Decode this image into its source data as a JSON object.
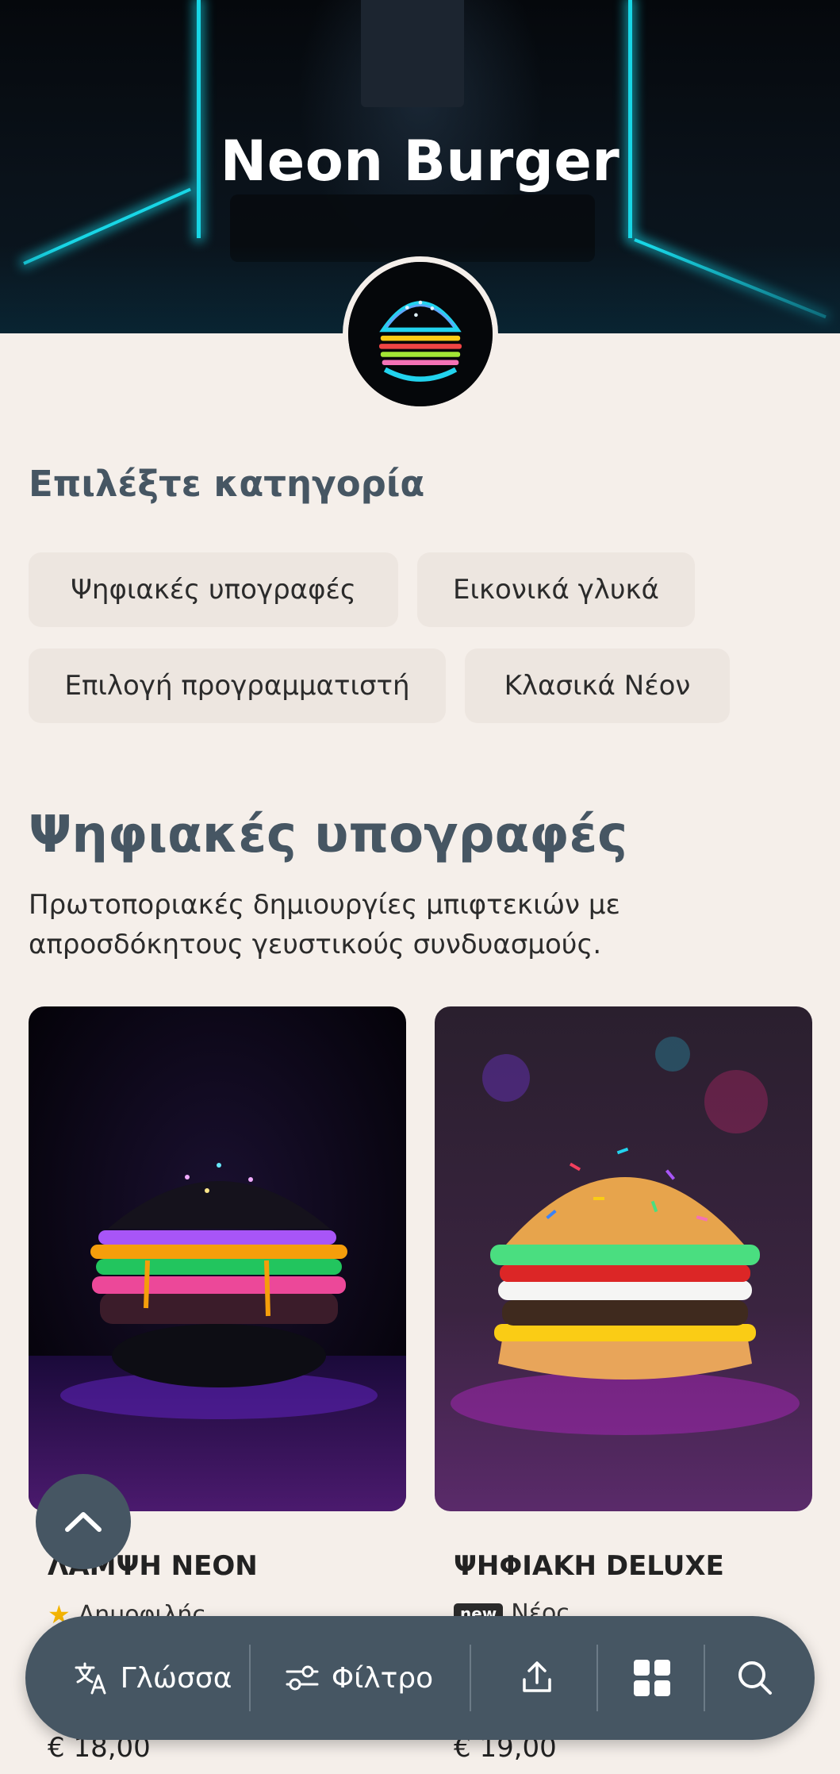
{
  "restaurant": {
    "name": "Neon Burger"
  },
  "categories": {
    "title": "Επιλέξτε κατηγορία",
    "items": [
      "Ψηφιακές υπογραφές",
      "Εικονικά γλυκά",
      "Επιλογή προγραμματιστή",
      "Κλασικά Νέον"
    ]
  },
  "section": {
    "title": "Ψηφιακές υπογραφές",
    "description_line1": "Πρωτοποριακές δημιουργίες μπιφτεκιών με",
    "description_line2": "απροσδόκητους γευστικούς συνδυασμούς."
  },
  "products": [
    {
      "name": "ΛΑΜΨΗ NEON",
      "badge_label": "Δημοφιλής",
      "badge_icon": "star-icon",
      "price": "€ 18,00"
    },
    {
      "name": "ΨΗΦΙΑΚΗ DELUXE",
      "badge_tag": "new",
      "badge_label": "Νέος",
      "price": "€ 19,00"
    }
  ],
  "bottom_bar": {
    "language_label": "Γλώσσα",
    "filter_label": "Φίλτρο",
    "share_icon": "share-icon",
    "grid_icon": "grid-icon",
    "search_icon": "search-icon"
  },
  "colors": {
    "background": "#f5efea",
    "chip": "#ede6e0",
    "heading": "#465663",
    "bar": "#465663",
    "neon_accent": "#18d6e6"
  }
}
